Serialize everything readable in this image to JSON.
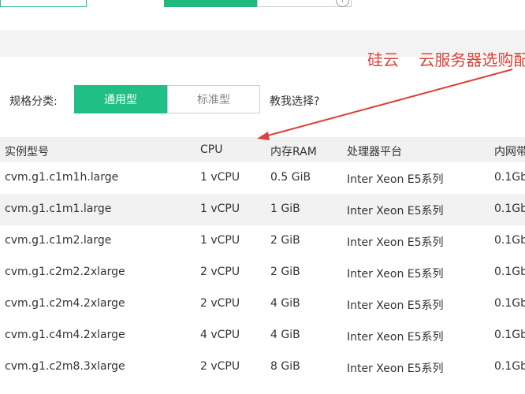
{
  "annotation": "硅云    云服务器选购配",
  "spec": {
    "label": "规格分类:",
    "tabs": [
      {
        "label": "通用型",
        "active": true
      },
      {
        "label": "标准型",
        "active": false
      }
    ],
    "help": "教我选择?"
  },
  "table": {
    "headers": [
      "实例型号",
      "CPU",
      "内存RAM",
      "处理器平台",
      "内网带"
    ],
    "rows": [
      [
        "cvm.g1.c1m1h.large",
        "1 vCPU",
        "0.5 GiB",
        "Inter Xeon E5系列",
        "0.1Gb"
      ],
      [
        "cvm.g1.c1m1.large",
        "1 vCPU",
        "1 GiB",
        "Inter Xeon E5系列",
        "0.1Gb"
      ],
      [
        "cvm.g1.c1m2.large",
        "1 vCPU",
        "2 GiB",
        "Inter Xeon E5系列",
        "0.1Gb"
      ],
      [
        "cvm.g1.c2m2.2xlarge",
        "2 vCPU",
        "2 GiB",
        "Inter Xeon E5系列",
        "0.1Gb"
      ],
      [
        "cvm.g1.c2m4.2xlarge",
        "2 vCPU",
        "4 GiB",
        "Inter Xeon E5系列",
        "0.1Gb"
      ],
      [
        "cvm.g1.c4m4.2xlarge",
        "4 vCPU",
        "4 GiB",
        "Inter Xeon E5系列",
        "0.1Gb"
      ],
      [
        "cvm.g1.c2m8.3xlarge",
        "2 vCPU",
        "8 GiB",
        "Inter Xeon E5系列",
        "0.1Gb"
      ]
    ]
  },
  "colors": {
    "accent": "#1fbf85",
    "annotation": "#d9433b"
  },
  "icons": {
    "top_right": "info-icon",
    "annotation_arrow": "arrow-icon"
  }
}
